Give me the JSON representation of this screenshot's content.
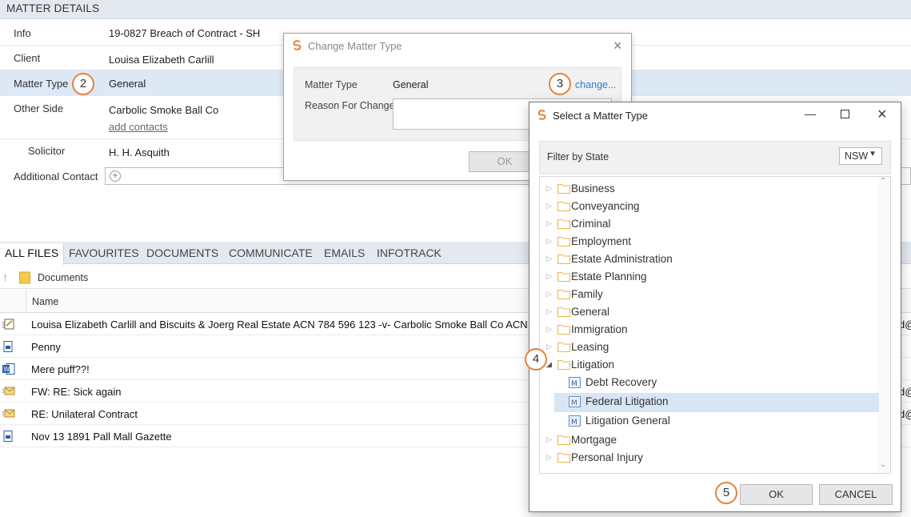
{
  "matter_details": {
    "header": "MATTER DETAILS",
    "fields": {
      "info": {
        "label": "Info",
        "value": "19-0827 Breach of Contract - SH"
      },
      "client": {
        "label": "Client",
        "value": "Louisa Elizabeth Carlill"
      },
      "matter_type": {
        "label": "Matter Type",
        "value": "General"
      },
      "other_side": {
        "label": "Other Side",
        "value": "Carbolic Smoke Ball Co",
        "link": "add contacts"
      },
      "solicitor": {
        "label": "Solicitor",
        "value": "H. H. Asquith"
      },
      "additional_contact": {
        "label": "Additional Contact"
      }
    }
  },
  "steps": {
    "s2": "2",
    "s3": "3",
    "s4": "4",
    "s5": "5"
  },
  "file_tabs": [
    "ALL FILES",
    "FAVOURITES",
    "DOCUMENTS",
    "COMMUNICATE",
    "EMAILS",
    "INFOTRACK"
  ],
  "breadcrumb": "Documents",
  "files_header": {
    "name": "Name"
  },
  "files": [
    {
      "name": "Louisa Elizabeth Carlill and Biscuits & Joerg Real Estate ACN 784 596 123 -v- Carbolic Smoke Ball Co ACN 123",
      "icon": "form-icon",
      "right": "d@"
    },
    {
      "name": "Penny",
      "icon": "document-icon",
      "right": ""
    },
    {
      "name": "Mere puff??!",
      "icon": "word-doc-icon",
      "right": ""
    },
    {
      "name": "FW: RE: Sick again",
      "icon": "email-icon",
      "right": "d@"
    },
    {
      "name": "RE: Unilateral Contract",
      "icon": "email-icon",
      "right": "d@"
    },
    {
      "name": "Nov 13 1891 Pall Mall Gazette",
      "icon": "document-icon",
      "right": ""
    }
  ],
  "change_dialog": {
    "title": "Change Matter Type",
    "matter_type_label": "Matter Type",
    "matter_type_value": "General",
    "change_link": "change...",
    "reason_label": "Reason For Change",
    "reason_value": "",
    "ok": "OK"
  },
  "select_dialog": {
    "title": "Select a Matter Type",
    "filter_label": "Filter by State",
    "state": "NSW",
    "tree": [
      {
        "label": "Business",
        "level": 0,
        "kind": "folder",
        "expanded": false
      },
      {
        "label": "Conveyancing",
        "level": 0,
        "kind": "folder",
        "expanded": false
      },
      {
        "label": "Criminal",
        "level": 0,
        "kind": "folder",
        "expanded": false
      },
      {
        "label": "Employment",
        "level": 0,
        "kind": "folder",
        "expanded": false
      },
      {
        "label": "Estate Administration",
        "level": 0,
        "kind": "folder",
        "expanded": false
      },
      {
        "label": "Estate Planning",
        "level": 0,
        "kind": "folder",
        "expanded": false
      },
      {
        "label": "Family",
        "level": 0,
        "kind": "folder",
        "expanded": false
      },
      {
        "label": "General",
        "level": 0,
        "kind": "folder",
        "expanded": false
      },
      {
        "label": "Immigration",
        "level": 0,
        "kind": "folder",
        "expanded": false
      },
      {
        "label": "Leasing",
        "level": 0,
        "kind": "folder",
        "expanded": false
      },
      {
        "label": "Litigation",
        "level": 0,
        "kind": "folder",
        "expanded": true
      },
      {
        "label": "Debt Recovery",
        "level": 1,
        "kind": "matter",
        "selected": false
      },
      {
        "label": "Federal Litigation",
        "level": 1,
        "kind": "matter",
        "selected": true
      },
      {
        "label": "Litigation General",
        "level": 1,
        "kind": "matter",
        "selected": false
      },
      {
        "label": "Mortgage",
        "level": 0,
        "kind": "folder",
        "expanded": false
      },
      {
        "label": "Personal Injury",
        "level": 0,
        "kind": "folder",
        "expanded": false
      }
    ],
    "ok": "OK",
    "cancel": "CANCEL"
  },
  "colors": {
    "accent": "#e5823a",
    "link": "#2f7bd0",
    "selected": "#d7e5f4",
    "folder": "#f2b340"
  }
}
